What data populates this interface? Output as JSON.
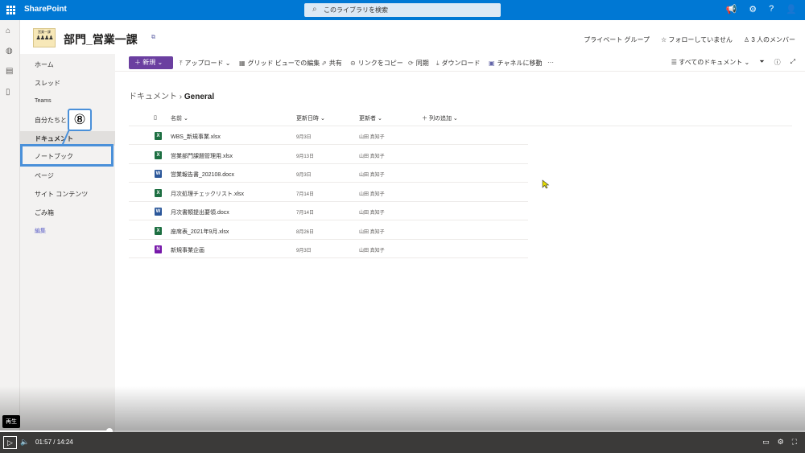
{
  "topbar": {
    "brand": "SharePoint",
    "search_placeholder": "このライブラリを検索"
  },
  "site": {
    "logo_text": "営業一課",
    "title": "部門_営業一課",
    "privacy": "プライベート グループ",
    "follow": "フォローしていません",
    "members": "3 人のメンバー"
  },
  "sidebar": {
    "items": [
      {
        "label": "ホーム"
      },
      {
        "label": "スレッド"
      },
      {
        "label": "Teams"
      },
      {
        "label": "自分たちと"
      },
      {
        "label": "ドキュメント"
      },
      {
        "label": "ノートブック"
      },
      {
        "label": "ページ"
      },
      {
        "label": "サイト コンテンツ"
      },
      {
        "label": "ごみ箱"
      }
    ],
    "edit_label": "編集"
  },
  "callout": {
    "number": "⑧"
  },
  "commandbar": {
    "new_label": "新規",
    "upload": "アップロード",
    "grid_edit": "グリッド ビューでの編集",
    "share": "共有",
    "copy_link": "リンクをコピー",
    "sync": "同期",
    "download": "ダウンロード",
    "move_channel": "チャネルに移動",
    "more": "···",
    "view": "すべてのドキュメント"
  },
  "breadcrumb": {
    "parent": "ドキュメント",
    "current": "General"
  },
  "columns": {
    "name": "名前",
    "modified": "更新日時",
    "modified_by": "更新者",
    "add_column": "列の追加"
  },
  "files": [
    {
      "name": "WBS_新規事業.xlsx",
      "date": "9月3日",
      "user": "山田 真知子",
      "type": "xlsx",
      "color": "#1d6f42"
    },
    {
      "name": "営業部門課題管理用.xlsx",
      "date": "9月13日",
      "user": "山田 真知子",
      "type": "xlsx",
      "color": "#1d6f42"
    },
    {
      "name": "営業報告書_202108.docx",
      "date": "9月3日",
      "user": "山田 真知子",
      "type": "docx",
      "color": "#2b579a"
    },
    {
      "name": "月次処理チェックリスト.xlsx",
      "date": "7月14日",
      "user": "山田 真知子",
      "type": "xlsx",
      "color": "#1d6f42"
    },
    {
      "name": "月次書類提出要領.docx",
      "date": "7月14日",
      "user": "山田 真知子",
      "type": "docx",
      "color": "#2b579a"
    },
    {
      "name": "座席表_2021年9月.xlsx",
      "date": "8月26日",
      "user": "山田 真知子",
      "type": "xlsx",
      "color": "#1d6f42"
    },
    {
      "name": "新規事業企画",
      "date": "9月3日",
      "user": "山田 真知子",
      "type": "one",
      "color": "#7719aa"
    }
  ],
  "player": {
    "tooltip": "再生",
    "current_time": "01:57",
    "separator": "/",
    "total_time": "14:24",
    "progress": 0.136
  }
}
